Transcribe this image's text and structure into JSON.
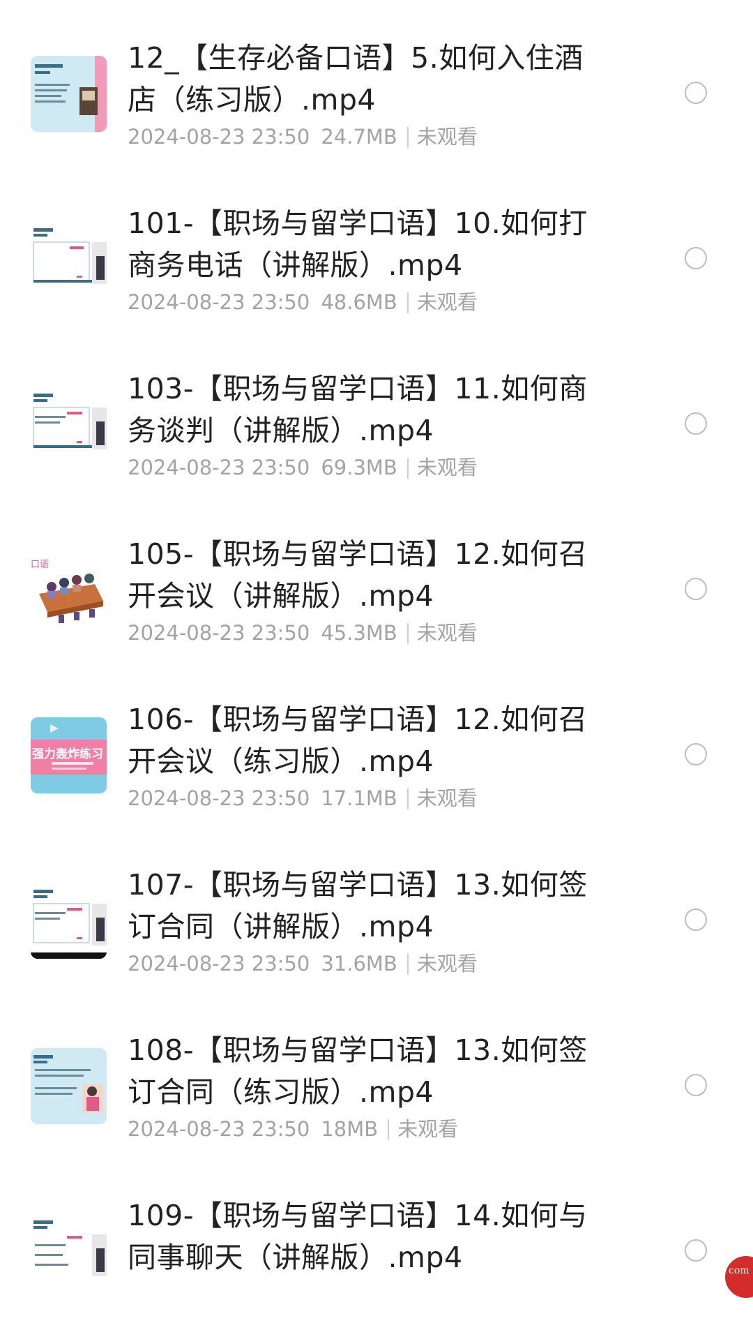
{
  "files": [
    {
      "title": "12_【生存必备口语】5.如何入住酒店（练习版）.mp4",
      "date": "2024-08-23 23:50",
      "size": "24.7MB",
      "status": "未观看",
      "thumb": "hotel-lesson-thumbnail"
    },
    {
      "title": "101-【职场与留学口语】10.如何打商务电话（讲解版）.mp4",
      "date": "2024-08-23 23:50",
      "size": "48.6MB",
      "status": "未观看",
      "thumb": "lesson-slide-thumbnail"
    },
    {
      "title": "103-【职场与留学口语】11.如何商务谈判（讲解版）.mp4",
      "date": "2024-08-23 23:50",
      "size": "69.3MB",
      "status": "未观看",
      "thumb": "lesson-slide-thumbnail"
    },
    {
      "title": "105-【职场与留学口语】12.如何召开会议（讲解版）.mp4",
      "date": "2024-08-23 23:50",
      "size": "45.3MB",
      "status": "未观看",
      "thumb": "meeting-illustration-thumbnail"
    },
    {
      "title": "106-【职场与留学口语】12.如何召开会议（练习版）.mp4",
      "date": "2024-08-23 23:50",
      "size": "17.1MB",
      "status": "未观看",
      "thumb": "practice-banner-thumbnail"
    },
    {
      "title": "107-【职场与留学口语】13.如何签订合同（讲解版）.mp4",
      "date": "2024-08-23 23:50",
      "size": "31.6MB",
      "status": "未观看",
      "thumb": "lesson-slide-thumbnail"
    },
    {
      "title": "108-【职场与留学口语】13.如何签订合同（练习版）.mp4",
      "date": "2024-08-23 23:50",
      "size": "18MB",
      "status": "未观看",
      "thumb": "practice-slide-thumbnail"
    },
    {
      "title": "109-【职场与留学口语】14.如何与同事聊天（讲解版）.mp4",
      "date": "",
      "size": "",
      "status": "",
      "thumb": "lesson-slide-thumbnail"
    }
  ],
  "thumb_texts": {
    "practice_banner": "强力轰炸练习",
    "meeting_label": "口语"
  },
  "corner_badge": "com",
  "colors": {
    "title": "#222222",
    "meta": "#a3a3a3",
    "radio_border": "#bdbdbd",
    "thumb_blue": "#cfeaf3",
    "thumb_pink": "#f07fa6",
    "badge_red": "#d42b2b"
  }
}
